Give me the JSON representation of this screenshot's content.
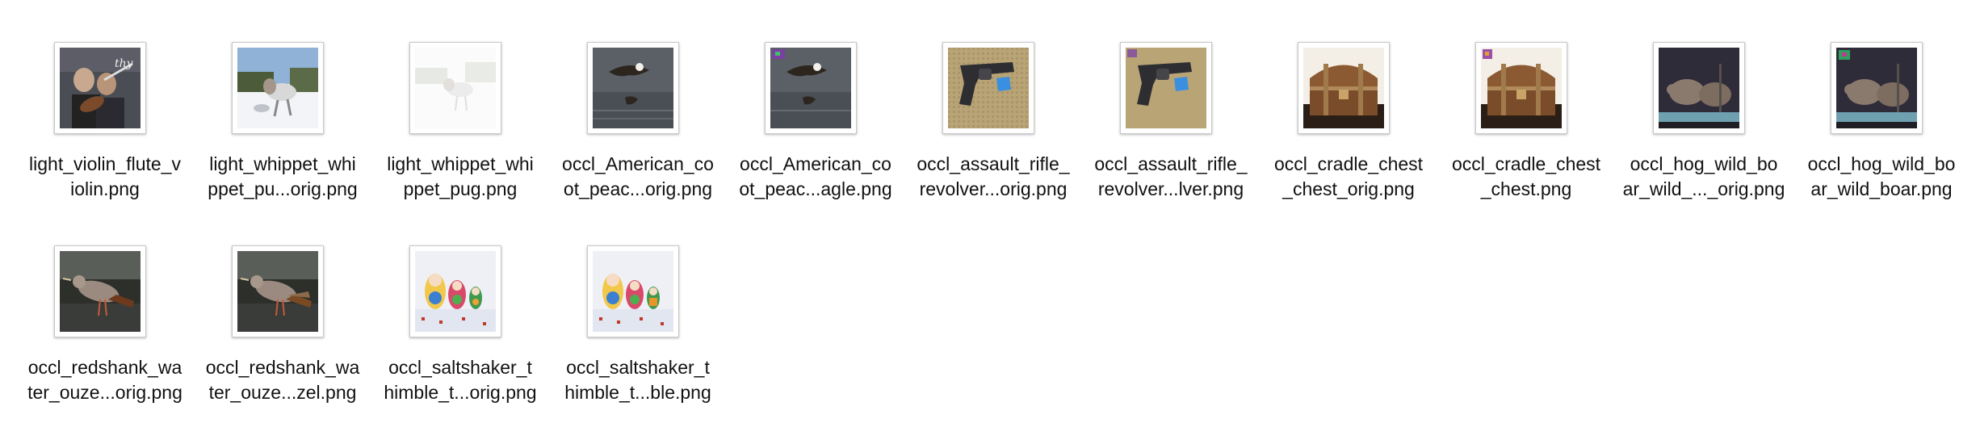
{
  "files": [
    {
      "name": "light_violin_flute_violin.png",
      "label_lines": [
        "light_violin_flute_v",
        "iolin.png"
      ],
      "thumbnail": "violin-flute-photo-icon"
    },
    {
      "name": "light_whippet_whippet_pug_orig.png",
      "label_lines": [
        "light_whippet_whi",
        "ppet_pu...orig.png"
      ],
      "thumbnail": "whippet-snow-photo-icon"
    },
    {
      "name": "light_whippet_whippet_pug.png",
      "label_lines": [
        "light_whippet_whi",
        "ppet_pug.png"
      ],
      "thumbnail": "whippet-faded-photo-icon"
    },
    {
      "name": "occl_American_coot_peacock_eagle_orig.png",
      "label_lines": [
        "occl_American_co",
        "ot_peac...orig.png"
      ],
      "thumbnail": "eagle-water-photo-icon"
    },
    {
      "name": "occl_American_coot_peacock_eagle.png",
      "label_lines": [
        "occl_American_co",
        "ot_peac...agle.png"
      ],
      "thumbnail": "eagle-water-patch-photo-icon"
    },
    {
      "name": "occl_assault_rifle_revolver_orig.png",
      "label_lines": [
        "occl_assault_rifle_",
        "revolver...orig.png"
      ],
      "thumbnail": "revolver-photo-icon"
    },
    {
      "name": "occl_assault_rifle_revolver.png",
      "label_lines": [
        "occl_assault_rifle_",
        "revolver...lver.png"
      ],
      "thumbnail": "revolver-patch-photo-icon"
    },
    {
      "name": "occl_cradle_chest_chest_orig.png",
      "label_lines": [
        "occl_cradle_chest",
        "_chest_orig.png"
      ],
      "thumbnail": "treasure-chest-photo-icon"
    },
    {
      "name": "occl_cradle_chest_chest.png",
      "label_lines": [
        "occl_cradle_chest",
        "_chest.png"
      ],
      "thumbnail": "treasure-chest-patch-photo-icon"
    },
    {
      "name": "occl_hog_wild_boar_wild_boar_orig.png",
      "label_lines": [
        "occl_hog_wild_bo",
        "ar_wild_..._orig.png"
      ],
      "thumbnail": "wild-boar-photo-icon"
    },
    {
      "name": "occl_hog_wild_boar_wild_boar.png",
      "label_lines": [
        "occl_hog_wild_bo",
        "ar_wild_boar.png"
      ],
      "thumbnail": "wild-boar-patch-photo-icon"
    },
    {
      "name": "occl_redshank_water_ouzel_orig.png",
      "label_lines": [
        "occl_redshank_wa",
        "ter_ouze...orig.png"
      ],
      "thumbnail": "redshank-bird-photo-icon"
    },
    {
      "name": "occl_redshank_water_ouzel.png",
      "label_lines": [
        "occl_redshank_wa",
        "ter_ouze...zel.png"
      ],
      "thumbnail": "redshank-bird-patch-photo-icon"
    },
    {
      "name": "occl_saltshaker_thimble_thimble_orig.png",
      "label_lines": [
        "occl_saltshaker_t",
        "himble_t...orig.png"
      ],
      "thumbnail": "nesting-dolls-photo-icon"
    },
    {
      "name": "occl_saltshaker_thimble_thimble.png",
      "label_lines": [
        "occl_saltshaker_t",
        "himble_t...ble.png"
      ],
      "thumbnail": "nesting-dolls-patch-photo-icon"
    }
  ]
}
